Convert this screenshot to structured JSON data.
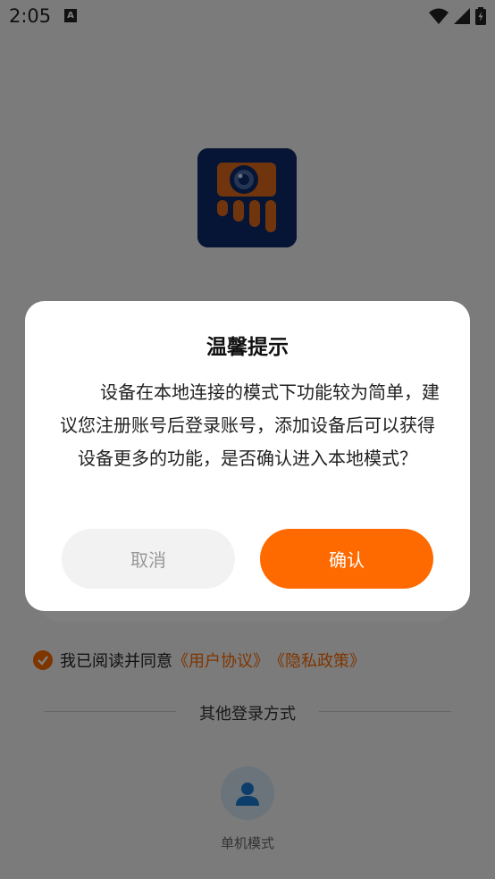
{
  "status_bar": {
    "time": "2:05",
    "notification_icon": "A"
  },
  "agreement": {
    "prefix": "我已阅读并同意",
    "user_agreement": "《用户协议》",
    "privacy_policy": "《隐私政策》"
  },
  "other_login": {
    "label": "其他登录方式"
  },
  "single_mode": {
    "label": "单机模式"
  },
  "dialog": {
    "title": "温馨提示",
    "message": "设备在本地连接的模式下功能较为简单，建议您注册账号后登录账号，添加设备后可以获得设备更多的功能，是否确认进入本地模式？",
    "cancel_label": "取消",
    "confirm_label": "确认"
  },
  "colors": {
    "accent": "#ff6a00",
    "logo_bg": "#0d2b6a"
  }
}
